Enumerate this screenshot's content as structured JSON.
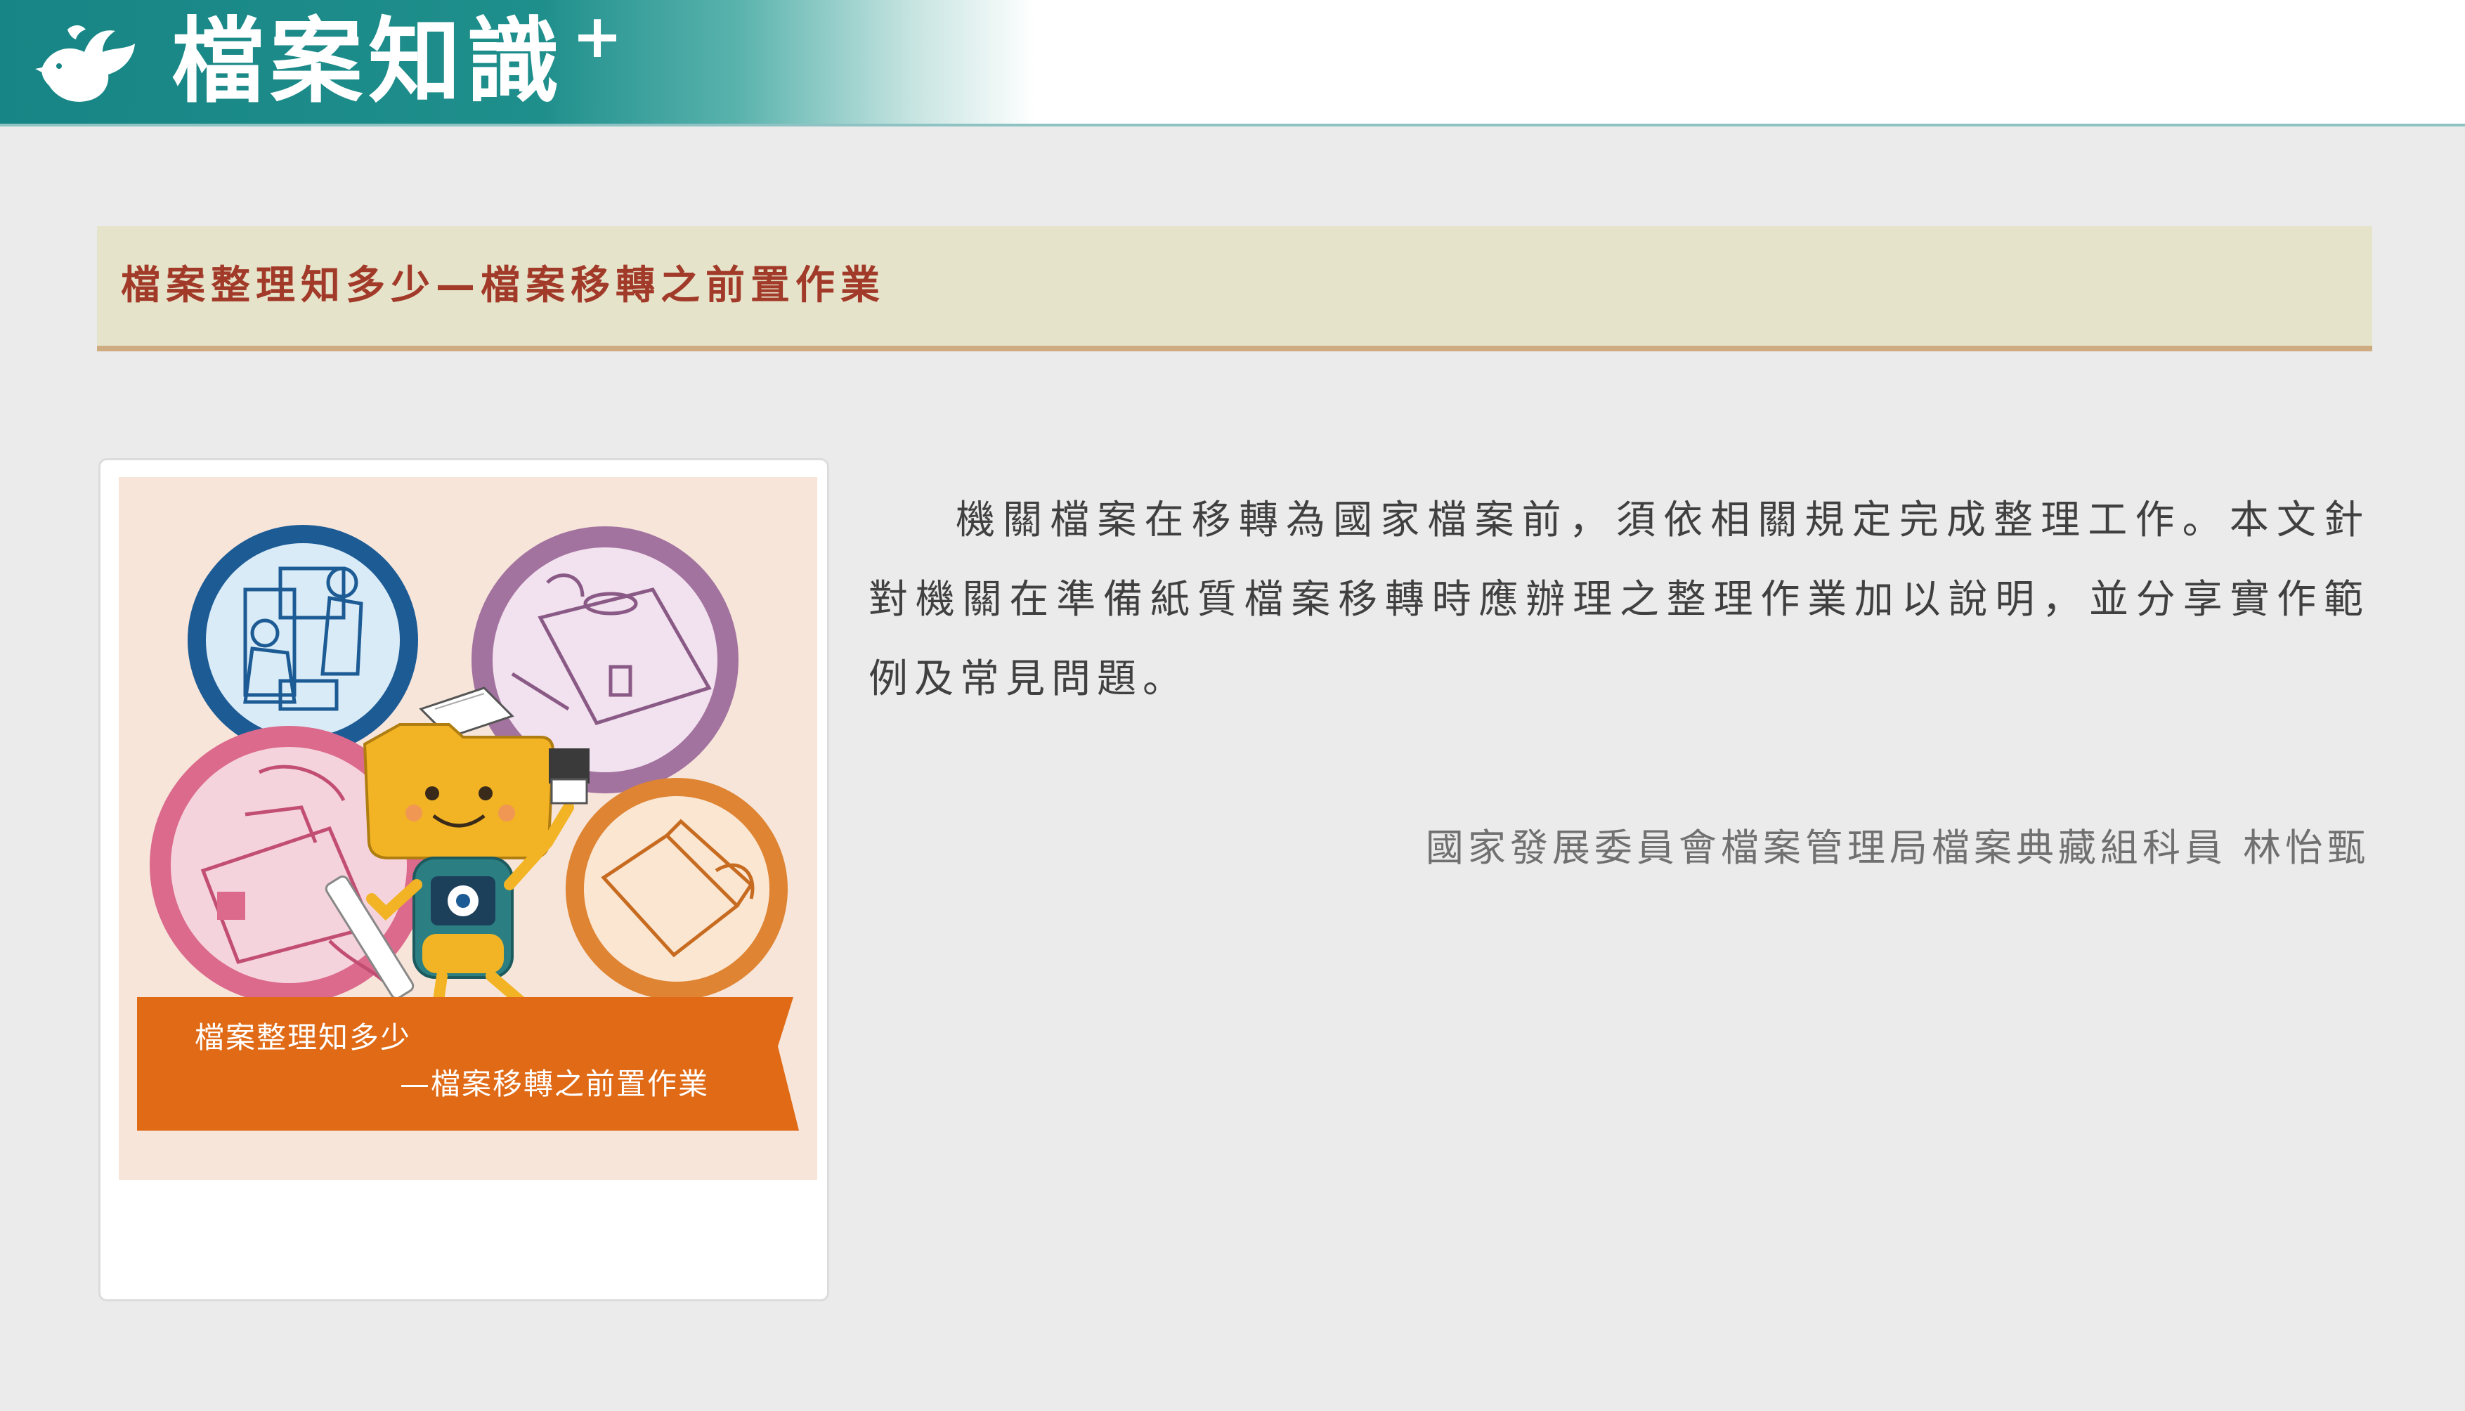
{
  "header": {
    "logo_text": "檔案知識",
    "logo_plus": "+",
    "logo_icon": "bird-logo-icon"
  },
  "article": {
    "title": "檔案整理知多少—檔案移轉之前置作業",
    "intro": "機關檔案在移轉為國家檔案前，須依相關規定完成整理工作。本文針對機關在準備紙質檔案移轉時應辦理之整理作業加以說明，並分享實作範例及常見問題。",
    "author": "國家發展委員會檔案管理局檔案典藏組科員 林怡甄"
  },
  "illustration": {
    "banner_line1": "檔案整理知多少",
    "banner_line2": "—檔案移轉之前置作業",
    "colors": {
      "background": "#f7e5da",
      "banner": "#e06a16",
      "circle_blue": "#1d5b95",
      "circle_purple": "#a3739f",
      "circle_pink": "#dc6a8c",
      "circle_orange": "#de8433",
      "mascot": "#f2b424"
    }
  },
  "theme": {
    "header_teal": "#178585",
    "title_bar_bg": "#e5e3c9",
    "title_color": "#a23a2a",
    "title_underline": "#cfab82",
    "page_bg": "#ebebeb"
  }
}
